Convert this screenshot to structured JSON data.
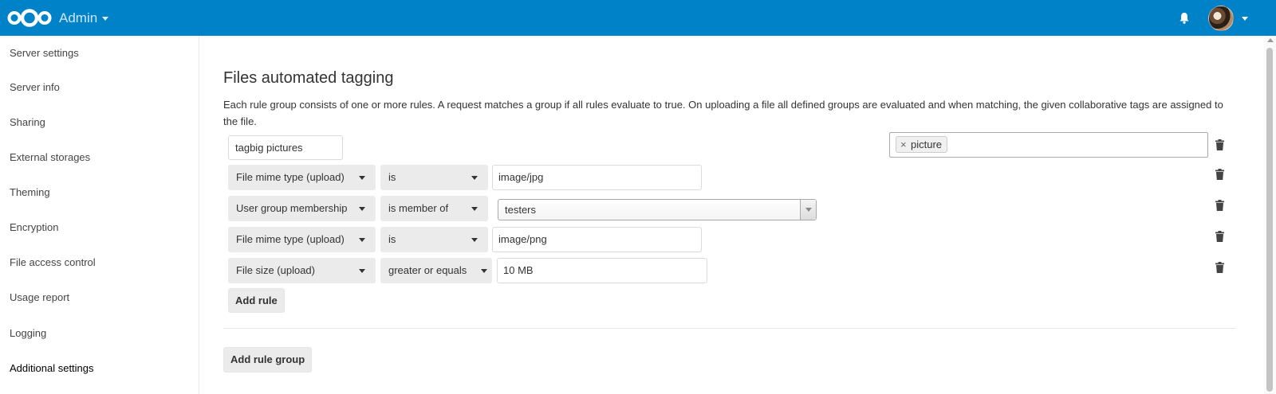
{
  "header": {
    "app_name": "Admin",
    "logo_icon": "nextcloud-logo-icon",
    "notification_icon": "bell-icon",
    "accent_color": "#0082c9"
  },
  "sidebar": {
    "items": [
      {
        "label": "Server settings"
      },
      {
        "label": "Server info"
      },
      {
        "label": "Sharing"
      },
      {
        "label": "External storages"
      },
      {
        "label": "Theming"
      },
      {
        "label": "Encryption"
      },
      {
        "label": "File access control"
      },
      {
        "label": "Usage report"
      },
      {
        "label": "Logging"
      },
      {
        "label": "Additional settings",
        "active": true
      }
    ]
  },
  "main": {
    "title": "Files automated tagging",
    "description": "Each rule group consists of one or more rules. A request matches a group if all rules evaluate to true. On uploading a file all defined groups are evaluated and when matching, the given collaborative tags are assigned to the file.",
    "group": {
      "name": "tagbig  pictures",
      "tags": [
        "picture"
      ],
      "rules": [
        {
          "check": "File mime type (upload)",
          "operator": "is",
          "value": "image/jpg"
        },
        {
          "check": "User group membership",
          "operator": "is member of",
          "value": "testers"
        },
        {
          "check": "File mime type (upload)",
          "operator": "is",
          "value": "image/png"
        },
        {
          "check": "File size (upload)",
          "operator": "greater or equals",
          "value": "10 MB"
        }
      ],
      "add_rule_label": "Add rule"
    },
    "add_rule_group_label": "Add rule group"
  }
}
